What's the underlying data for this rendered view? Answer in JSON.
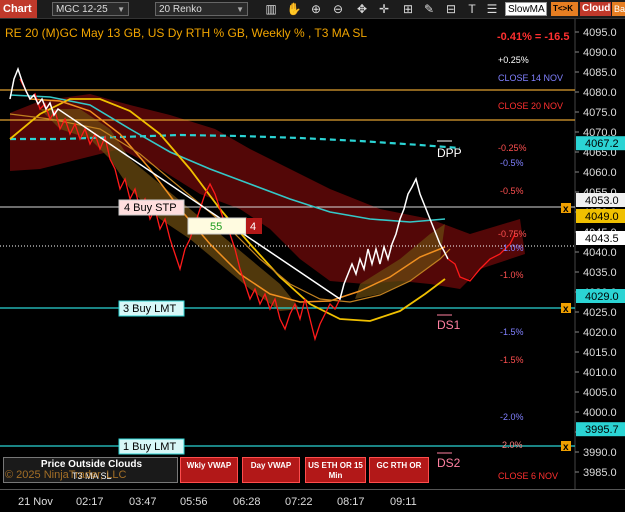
{
  "toolbar": {
    "chart_label": "Chart",
    "instrument": "MGC 12-25",
    "bar_type": "20 Renko",
    "strategy": "SlowMA",
    "tck_label": "T<>K",
    "cloud_label": "Cloud",
    "band_label": "Band",
    "icons": [
      "bar-chart-icon",
      "hand-icon",
      "zoom-in-icon",
      "zoom-out-icon",
      "move-icon",
      "crosshair-icon",
      "grid-icon",
      "drawing-icon",
      "ruler-icon",
      "text-icon",
      "list-icon",
      "settings-icon"
    ]
  },
  "header": {
    "title": "RE 20  (M)GC May 13 GB, US Dy RTH % GB, Weekly % , T3 MA SL",
    "change": "-0.41% = -16.5"
  },
  "price_axis": {
    "ticks": [
      "4095.0",
      "4090.0",
      "4085.0",
      "4080.0",
      "4075.0",
      "4070.0",
      "4065.0",
      "4060.0",
      "4055.0",
      "4050.0",
      "4045.0",
      "4040.0",
      "4035.0",
      "4030.0",
      "4025.0",
      "4020.0",
      "4015.0",
      "4010.0",
      "4005.0",
      "4000.0",
      "3995.0",
      "3990.0",
      "3985.0"
    ],
    "badges": [
      {
        "text": "4067.2",
        "color": "#2bd4d4",
        "text_color": "#000"
      },
      {
        "text": "4053.0",
        "color": "#f0f0f0",
        "text_color": "#000"
      },
      {
        "text": "4049.0",
        "color": "#f0c000",
        "text_color": "#000"
      },
      {
        "text": "4043.5",
        "color": "#ffffff",
        "text_color": "#000"
      },
      {
        "text": "4029.0",
        "color": "#2bd4d4",
        "text_color": "#000"
      },
      {
        "text": "3995.7",
        "color": "#2bd4d4",
        "text_color": "#000"
      }
    ]
  },
  "levels": {
    "pct": [
      "+0.25%",
      "-0.25%",
      "-0.5%",
      "-0.5%",
      "-0.75%",
      "-1.0%",
      "-1.0%",
      "-1.5%",
      "-1.5%",
      "-2.0%",
      "2.0%"
    ],
    "close_14": "CLOSE 14 NOV",
    "close_20": "CLOSE 20 NOV",
    "close_6": "CLOSE 6 NOV",
    "dpp": "DPP",
    "ds1": "DS1",
    "ds2": "DS2"
  },
  "orders": {
    "buy_stp": "4 Buy STP",
    "buy_lmt_3": "3 Buy LMT",
    "buy_lmt_1": "1 Buy LMT",
    "pos_qty": "55",
    "pos_ct": "4"
  },
  "bottom": {
    "poc_title": "Price Outside Clouds",
    "poc_sub": "T3 MA SL",
    "copyright": "© 2025 NinjaTrader, LLC",
    "buttons": [
      "Wkly VWAP",
      "Day VWAP",
      "US ETH OR 15 Min",
      "GC RTH OR"
    ]
  },
  "xaxis": [
    "21 Nov",
    "02:17",
    "03:47",
    "05:56",
    "06:28",
    "07:22",
    "08:17",
    "09:11"
  ],
  "colors": {
    "accent": "#e67e22",
    "cyan": "#2bd4d4",
    "yellow": "#f0c000",
    "red": "#ff2020",
    "cloud_red": "#5a0a0a",
    "cloud_orange": "#5a3a0a"
  }
}
